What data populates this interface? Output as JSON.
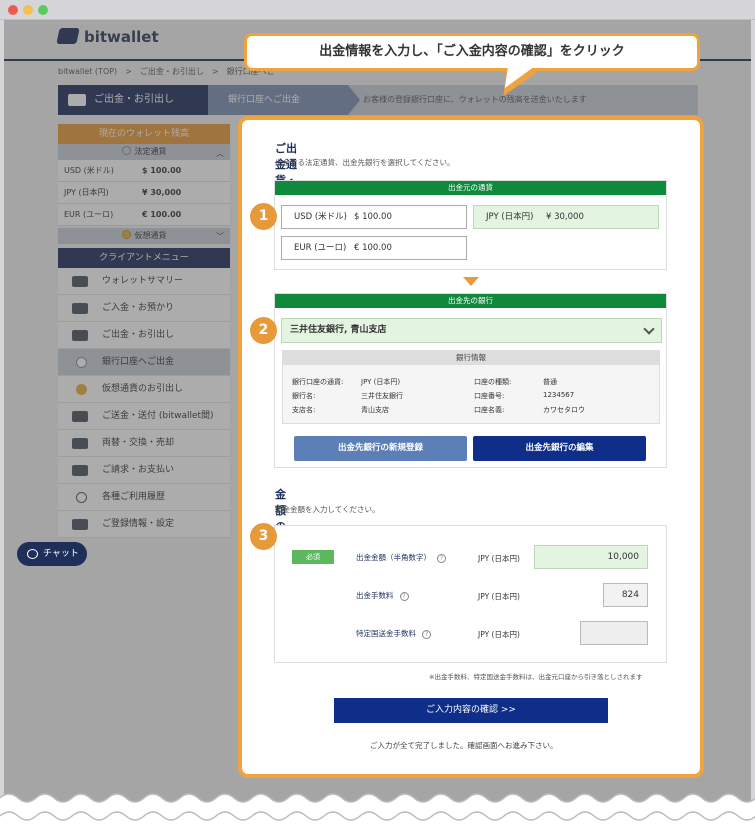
{
  "window": {
    "dots": [
      "#ee5a52",
      "#f6bf4f",
      "#5ccb5f"
    ]
  },
  "header": {
    "logo": "bitwallet"
  },
  "breadcrumb": "bitwallet (TOP)　>　ご出金・お引出し　>　銀行口座へご",
  "steps": {
    "step1": "ご出金・お引出し",
    "step2": "銀行口座へご出金",
    "step3": "お客様の登録銀行口座に、ウォレットの残高を送金いたします"
  },
  "sidebar": {
    "balance_title": "現在のウォレット残高",
    "legal_label": "法定通貨",
    "balances": [
      {
        "cur": "USD (米ドル)",
        "val": "$ 100.00"
      },
      {
        "cur": "JPY (日本円)",
        "val": "¥ 30,000"
      },
      {
        "cur": "EUR (ユーロ)",
        "val": "€ 100.00"
      }
    ],
    "virtual_label": "仮想通貨",
    "menu_title": "クライアントメニュー",
    "menu": [
      "ウォレットサマリー",
      "ご入金・お預かり",
      "ご出金・お引出し",
      "銀行口座へご出金",
      "仮想通貨のお引出し",
      "ご送金・送付 (bitwallet間)",
      "両替・交換・売却",
      "ご請求・お支払い",
      "各種ご利用履歴",
      "ご登録情報・設定"
    ]
  },
  "chat": "チャット",
  "callout": "出金情報を入力し、「ご入金内容の確認」をクリック",
  "form": {
    "section1_title": "ご出金通貨・銀行の登録",
    "section1_desc": "出金する法定通貨、出金先銀行を選択してください。",
    "source_bar": "出金元の通貨",
    "currencies": [
      {
        "cur": "USD (米ドル)",
        "val": "$ 100.00"
      },
      {
        "cur": "JPY (日本円)",
        "val": "¥ 30,000"
      },
      {
        "cur": "EUR (ユーロ)",
        "val": "€ 100.00"
      }
    ],
    "bank_bar": "出金先の銀行",
    "bank_selected": "三井住友銀行, 青山支店",
    "bank_info_title": "銀行情報",
    "bank_info": {
      "l1": "銀行口座の通貨:",
      "v1": "JPY (日本円)",
      "l2": "銀行名:",
      "v2": "三井住友銀行",
      "l3": "支店名:",
      "v3": "青山支店",
      "r1": "口座の種類:",
      "rv1": "普通",
      "r2": "口座番号:",
      "rv2": "1234567",
      "r3": "口座名義:",
      "rv3": "カワセタロウ"
    },
    "btn_new": "出金先銀行の新規登録",
    "btn_edit": "出金先銀行の編集",
    "section2_title": "金額の入力",
    "section2_desc": "出金金額を入力してください。",
    "required": "必須",
    "amount_label": "出金金額（半角数字）",
    "fee_label": "出金手数料",
    "intl_fee_label": "特定国送金手数料",
    "currency": "JPY (日本円)",
    "amount": "10,000",
    "fee": "824",
    "intl_fee": "",
    "note": "※出金手数料、特定国送金手数料は、出金元口座から引き落としされます",
    "confirm": "ご入力内容の確認 >>",
    "done": "ご入力が全て完了しました。確認画面へお進み下さい。"
  },
  "badges": [
    "1",
    "2",
    "3"
  ]
}
